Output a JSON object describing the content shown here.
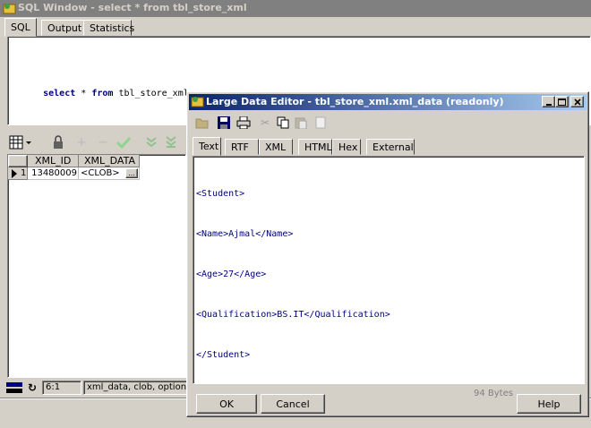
{
  "sql_window": {
    "title": "SQL Window - select * from tbl_store_xml",
    "tabs": [
      "SQL",
      "Output",
      "Statistics"
    ],
    "query_keyword_select": "select",
    "query_star": "*",
    "query_keyword_from": "from",
    "query_table": "tbl_store_xml",
    "grid": {
      "columns": [
        "XML_ID",
        "XML_DATA"
      ],
      "rows": [
        {
          "row_no": "1",
          "xml_id": "13480009",
          "xml_data": "<CLOB>",
          "ellipsis": "..."
        }
      ]
    },
    "status": {
      "position": "6:1",
      "field_info": "xml_data, clob, optional"
    }
  },
  "editor": {
    "title": "Large Data Editor - tbl_store_xml.xml_data (readonly)",
    "tabs": [
      "Text",
      "RTF",
      "XML",
      "HTML",
      "Hex",
      "External"
    ],
    "content_lines": [
      "<Student>",
      "<Name>Ajmal</Name>",
      "<Age>27</Age>",
      "<Qualification>BS.IT</Qualification>",
      "</Student>"
    ],
    "size_label": "94 Bytes",
    "ok_label": "OK",
    "cancel_label": "Cancel",
    "help_label": "Help"
  },
  "colors": {
    "keyword": "#000080",
    "xml_text": "#000080",
    "active_title_start": "#0a246a",
    "active_title_end": "#a6caf0",
    "inactive_title": "#808080"
  }
}
